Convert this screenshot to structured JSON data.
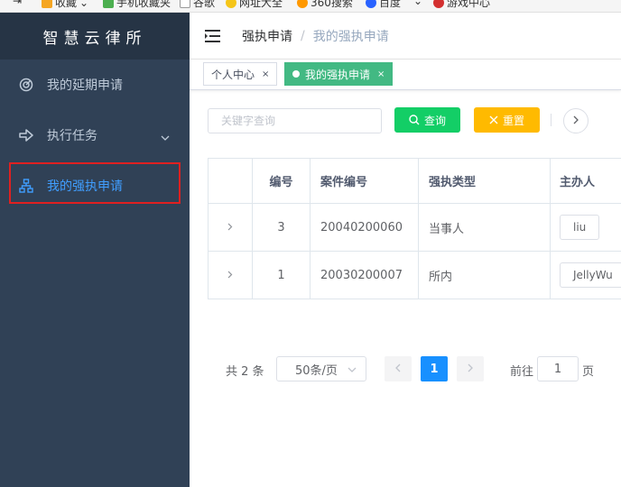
{
  "bookmarks": [
    {
      "label": "收藏",
      "color": "#f5a623"
    },
    {
      "label": "手机收藏夹",
      "color": "#4caf50"
    },
    {
      "label": "谷歌",
      "color": "#ffffff"
    },
    {
      "label": "网址大全",
      "color": "#f5c518"
    },
    {
      "label": "360搜索",
      "color": "#ff9800"
    },
    {
      "label": "百度",
      "color": "#2962ff"
    },
    {
      "label": "游戏中心",
      "color": "#d32f2f"
    }
  ],
  "app": {
    "title": "智慧云律所"
  },
  "sidebar": {
    "items": [
      {
        "label": "我的延期申请",
        "icon": "radar-icon"
      },
      {
        "label": "执行任务",
        "icon": "arrow-right-icon"
      },
      {
        "label": "我的强执申请",
        "icon": "org-tree-icon"
      }
    ]
  },
  "header": {
    "breadcrumb": [
      "强执申请",
      "我的强执申请"
    ],
    "separator": "/"
  },
  "tags": [
    {
      "label": "个人中心",
      "active": false
    },
    {
      "label": "我的强执申请",
      "active": true
    }
  ],
  "tag_close": "×",
  "search": {
    "placeholder": "关键字查询",
    "query_label": "查询",
    "reset_label": "重置"
  },
  "table": {
    "columns": [
      "编号",
      "案件编号",
      "强执类型",
      "主办人"
    ],
    "rows": [
      {
        "no": "3",
        "case": "20040200060",
        "type": "当事人",
        "host": "liu"
      },
      {
        "no": "1",
        "case": "20030200007",
        "type": "所内",
        "host": "JellyWu"
      }
    ]
  },
  "pagination": {
    "total": "共 2 条",
    "page_size": "50条/页",
    "current": "1",
    "goto_label": "前往",
    "goto_value": "1",
    "page_label": "页"
  },
  "colors": {
    "sidebar_bg": "#304156",
    "active": "#409eff",
    "tag_active": "#42b983",
    "query_btn": "#13ce66",
    "reset_btn": "#ffba00",
    "page_active": "#1890ff",
    "highlight_border": "#e02020"
  }
}
